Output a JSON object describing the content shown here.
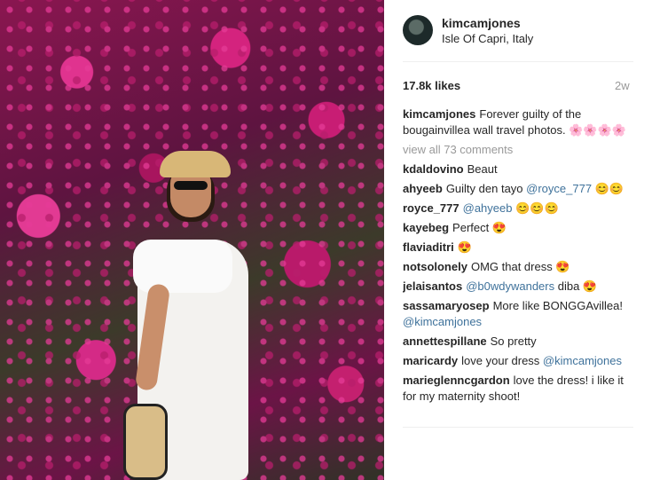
{
  "post": {
    "username": "kimcamjones",
    "location": "Isle Of Capri, Italy",
    "likes": "17.8k likes",
    "age": "2w",
    "caption": {
      "user": "kimcamjones",
      "text": "Forever guilty of the bougainvillea wall travel photos. 🌸🌸🌸🌸"
    },
    "view_all": "view all 73 comments"
  },
  "comments": [
    {
      "user": "kdaldovino",
      "text": "Beaut"
    },
    {
      "user": "ahyeeb",
      "text": "Guilty den tayo ",
      "mention": "@royce_777",
      "after": " 😊😊"
    },
    {
      "user": "royce_777",
      "text": "",
      "mention": "@ahyeeb",
      "after": " 😊😊😊"
    },
    {
      "user": "kayebeg",
      "text": "Perfect 😍"
    },
    {
      "user": "flaviaditri",
      "text": "😍"
    },
    {
      "user": "notsolonely",
      "text": "OMG that dress 😍"
    },
    {
      "user": "jelaisantos",
      "text": "",
      "mention": "@b0wdywanders",
      "after": " diba 😍"
    },
    {
      "user": "sassamaryosep",
      "text": "More like BONGGAvillea! ",
      "mention": "@kimcamjones",
      "after": ""
    },
    {
      "user": "annettespillane",
      "text": "So pretty"
    },
    {
      "user": "maricardy",
      "text": "love your dress ",
      "mention": "@kimcamjones",
      "after": ""
    },
    {
      "user": "marieglenncgardon",
      "text": "love the dress! i like it for my maternity shoot!"
    }
  ]
}
